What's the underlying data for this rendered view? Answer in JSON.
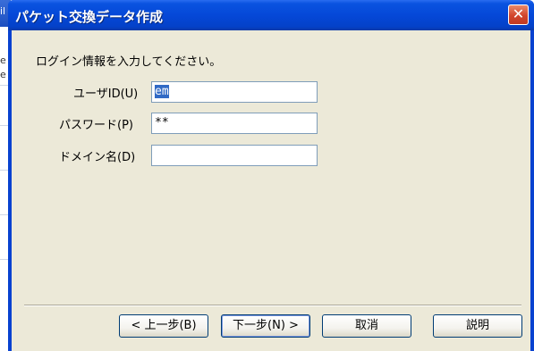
{
  "background": {
    "fragments": [
      "il",
      "e",
      "e"
    ]
  },
  "window": {
    "title": "パケット交換データ作成",
    "close_glyph": "✕"
  },
  "dialog": {
    "prompt": "ログイン情報を入力してください。",
    "fields": [
      {
        "label": "ユーザID(U)",
        "value": "em",
        "placeholder": ""
      },
      {
        "label": "パスワード(P)",
        "value": "**",
        "placeholder": ""
      },
      {
        "label": "ドメイン名(D)",
        "value": "",
        "placeholder": ""
      }
    ]
  },
  "buttons": {
    "back": "< 上一步(B)",
    "next": "下一步(N) >",
    "cancel": "取消",
    "help": "説明"
  },
  "colors": {
    "titlebar": "#0548d8",
    "dialog_bg": "#ece9d8",
    "close_button": "#d2452c",
    "selection": "#316ac5"
  }
}
